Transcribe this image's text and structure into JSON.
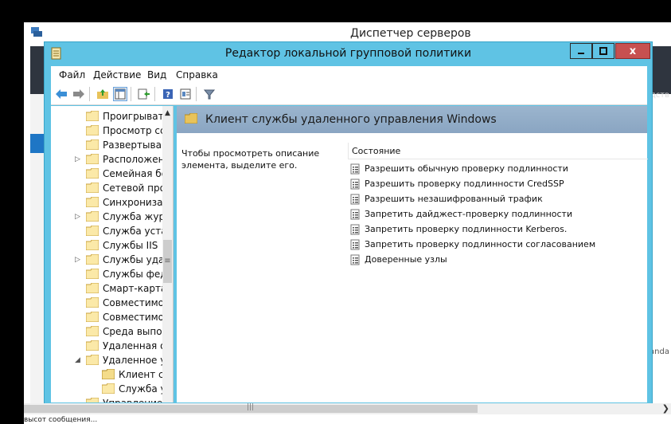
{
  "background_window": {
    "title": "Диспетчер серверов",
    "right_text_top": "дств",
    "right_text_mid": "anda",
    "status_text": "высот сообщения..."
  },
  "editor": {
    "title": "Редактор локальной групповой политики",
    "close_glyph": "x",
    "menu": [
      "Файл",
      "Действие",
      "Вид",
      "Справка"
    ],
    "tree": [
      {
        "label": "Проигрывате",
        "expander": ""
      },
      {
        "label": "Просмотр сс",
        "expander": ""
      },
      {
        "label": "Развертыван",
        "expander": ""
      },
      {
        "label": "Расположен",
        "expander": "▷"
      },
      {
        "label": "Семейная бе",
        "expander": ""
      },
      {
        "label": "Сетевой про",
        "expander": ""
      },
      {
        "label": "Синхронизац",
        "expander": ""
      },
      {
        "label": "Служба журн",
        "expander": "▷"
      },
      {
        "label": "Служба устан",
        "expander": ""
      },
      {
        "label": "Службы IIS",
        "expander": ""
      },
      {
        "label": "Службы удал",
        "expander": "▷"
      },
      {
        "label": "Службы фед",
        "expander": ""
      },
      {
        "label": "Смарт-карта",
        "expander": ""
      },
      {
        "label": "Совместимо",
        "expander": ""
      },
      {
        "label": "Совместимо",
        "expander": ""
      },
      {
        "label": "Среда выпол",
        "expander": ""
      },
      {
        "label": "Удаленная об",
        "expander": ""
      },
      {
        "label": "Удаленное уп",
        "expander": "◢"
      },
      {
        "label": "Клиент сл",
        "expander": "",
        "indent": 1,
        "selected": true
      },
      {
        "label": "Служба у",
        "expander": "",
        "indent": 1
      },
      {
        "label": "Управление",
        "expander": ""
      }
    ],
    "content_title": "Клиент службы удаленного управления Windows",
    "description": "Чтобы просмотреть описание элемента, выделите его.",
    "column_header": "Состояние",
    "policies": [
      "Разрешить обычную проверку подлинности",
      "Разрешить проверку подлинности CredSSP",
      "Разрешить незашифрованный трафик",
      "Запретить дайджест-проверку подлинности",
      "Запретить проверку подлинности Kerberos.",
      "Запретить проверку подлинности согласованием",
      "Доверенные узлы"
    ]
  },
  "icons": {
    "back": "arrow-left-icon",
    "forward": "arrow-right-icon",
    "up": "folder-up-icon",
    "show_hide_tree": "console-tree-icon",
    "export": "export-list-icon",
    "help": "help-icon",
    "extended_view": "extended-view-icon",
    "filter": "filter-icon"
  },
  "colors": {
    "title_bar": "#5fc3e4",
    "close_button": "#c75050",
    "content_header": "#8aa5c2",
    "folder": "#e8c35a"
  }
}
